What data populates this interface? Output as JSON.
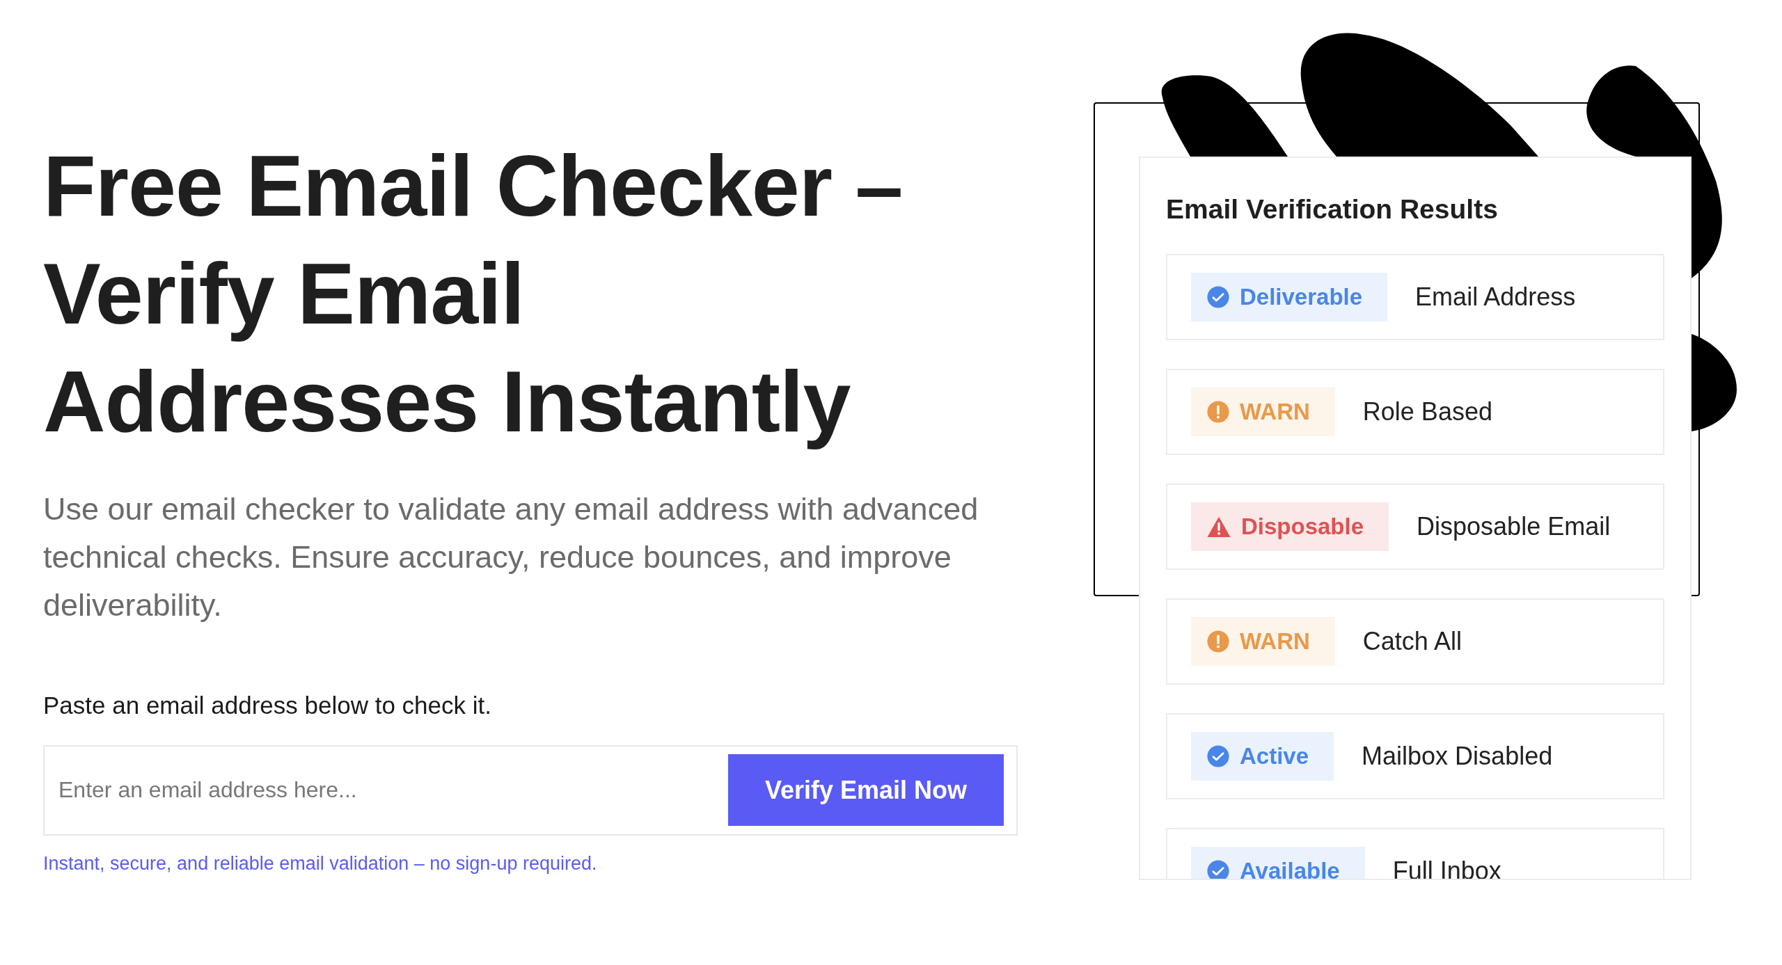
{
  "hero": {
    "title": "Free Email Checker – Verify Email Addresses Instantly",
    "description": "Use our email checker to validate any email address with advanced technical checks. Ensure accuracy, reduce bounces, and improve deliverability."
  },
  "form": {
    "label": "Paste an email address below to check it.",
    "placeholder": "Enter an email address here...",
    "button": "Verify Email Now",
    "note": "Instant, secure, and reliable email validation – no sign-up required."
  },
  "results": {
    "title": "Email Verification Results",
    "rows": [
      {
        "kind": "success",
        "badge": "Deliverable",
        "label": "Email Address"
      },
      {
        "kind": "warning",
        "badge": "WARN",
        "label": "Role Based"
      },
      {
        "kind": "danger",
        "badge": "Disposable",
        "label": "Disposable Email"
      },
      {
        "kind": "warning",
        "badge": "WARN",
        "label": "Catch All"
      },
      {
        "kind": "success",
        "badge": "Active",
        "label": "Mailbox Disabled"
      },
      {
        "kind": "success",
        "badge": "Available",
        "label": "Full Inbox"
      }
    ]
  }
}
